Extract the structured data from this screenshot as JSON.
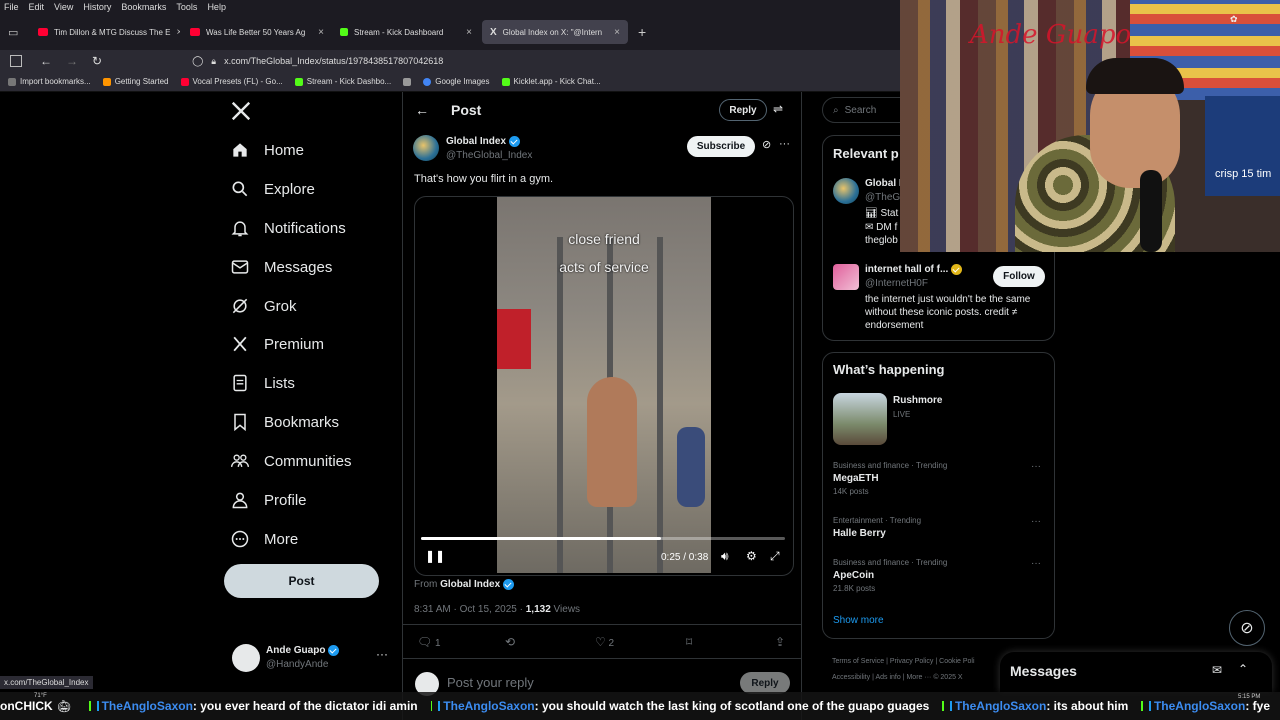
{
  "browser": {
    "menu": [
      "File",
      "Edit",
      "View",
      "History",
      "Bookmarks",
      "Tools",
      "Help"
    ],
    "tabs": [
      {
        "label": "Tim Dillon & MTG Discuss The E",
        "color": "#ff0033"
      },
      {
        "label": "Was Life Better 50 Years Ag",
        "color": "#ff0033"
      },
      {
        "label": "Stream - Kick Dashboard",
        "color": "#53fc18"
      },
      {
        "label": "Global Index on X: \"@Intern",
        "color": "#ffffff"
      }
    ],
    "url": "x.com/TheGlobal_Index/status/1978438517807042618",
    "bookmarks": [
      "Import bookmarks...",
      "Getting Started",
      "Vocal Presets (FL) - Go...",
      "Stream - Kick Dashbo...",
      "",
      "Google Images",
      "Kicklet.app - Kick Chat..."
    ],
    "status_url": "x.com/TheGlobal_Index"
  },
  "nav": {
    "items": [
      "Home",
      "Explore",
      "Notifications",
      "Messages",
      "Grok",
      "Premium",
      "Lists",
      "Bookmarks",
      "Communities",
      "Profile",
      "More"
    ],
    "post_label": "Post",
    "account": {
      "name": "Ande Guapo",
      "handle": "@HandyAnde"
    }
  },
  "post": {
    "header_title": "Post",
    "reply_label": "Reply",
    "author_name": "Global Index",
    "author_handle": "@TheGlobal_Index",
    "subscribe_label": "Subscribe",
    "text": "That's how you flirt in a gym.",
    "video_caption_line1": "close friend",
    "video_caption_line2": "acts of service",
    "video_time": "0:25 / 0:38",
    "video_progress": 0.66,
    "from_label": "From",
    "from_name": "Global Index",
    "timestamp": "8:31 AM · Oct 15, 2025 · ",
    "views_count": "1,132",
    "views_label": " Views",
    "reply_count": "1",
    "like_count": "2",
    "reply_placeholder": "Post your reply",
    "reply_button": "Reply"
  },
  "right": {
    "search_placeholder": "Search",
    "relevant_title": "Relevant p",
    "rel1": {
      "name": "Global I",
      "handle": "@TheGl",
      "line1": "Stat",
      "line2": "DM f",
      "line3": "theglob"
    },
    "rel2": {
      "name": "internet hall of f...",
      "handle": "@InternetH0F",
      "bio": "the internet just wouldn't be the same without these iconic posts. credit ≠ endorsement",
      "follow": "Follow"
    },
    "happening_title": "What’s happening",
    "live": {
      "name": "Rushmore",
      "status": "LIVE"
    },
    "trends": [
      {
        "meta": "Business and finance · Trending",
        "name": "MegaETH",
        "count": "14K posts"
      },
      {
        "meta": "Entertainment · Trending",
        "name": "Halle Berry",
        "count": ""
      },
      {
        "meta": "Business and finance · Trending",
        "name": "ApeCoin",
        "count": "21.8K posts"
      }
    ],
    "show_more": "Show more",
    "footer": [
      "Terms of Service",
      "Privacy Policy",
      "Cookie Poli",
      "Accessibility",
      "Ads info",
      "More ···",
      "© 2025 X"
    ],
    "messages_label": "Messages"
  },
  "ticker": {
    "lead": "onCHICK",
    "messages": [
      {
        "user": "TheAngloSaxon",
        "text": ": you ever heard of the dictator idi amin"
      },
      {
        "user": "TheAngloSaxon",
        "text": ": you should watch the last king of scotland one of the guapo guages"
      },
      {
        "user": "TheAngloSaxon",
        "text": ": its about him"
      },
      {
        "user": "TheAngloSaxon",
        "text": ": fye"
      }
    ]
  },
  "taskbar": {
    "temp": "71°F",
    "time": "5:15 PM"
  },
  "webcam": {
    "sign": "Ande Guapo",
    "shirt_text": "crisp 15 tim"
  }
}
